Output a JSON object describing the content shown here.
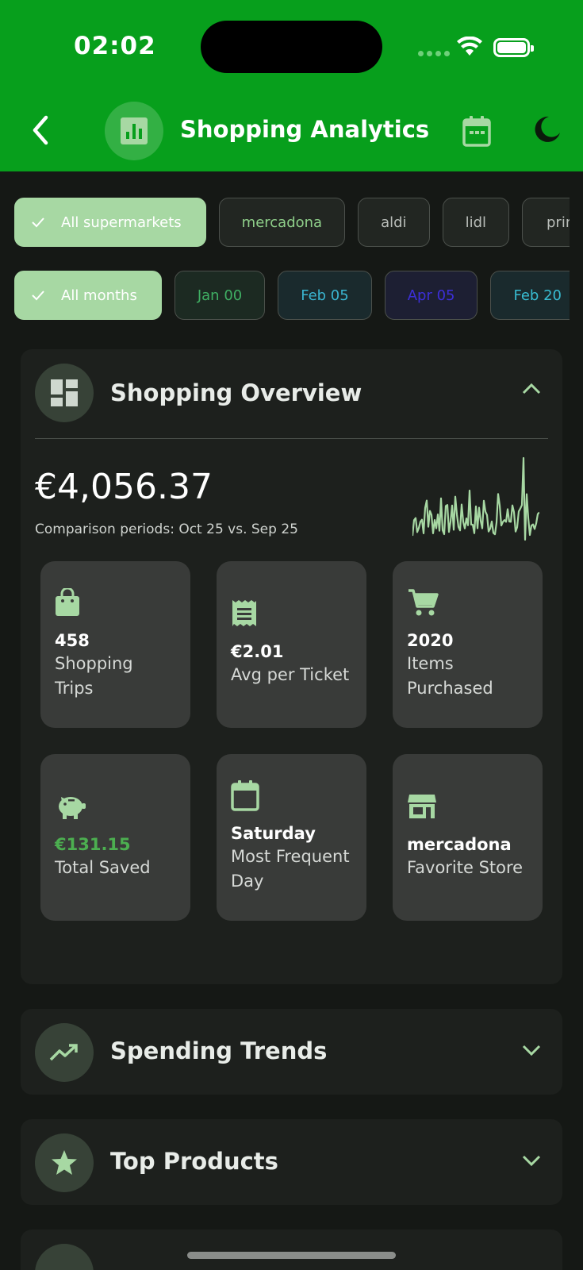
{
  "status_bar": {
    "time": "02:02"
  },
  "app_bar": {
    "title": "Shopping Analytics"
  },
  "filters": {
    "stores": [
      {
        "label": "All supermarkets",
        "selected": true,
        "color": "#ffffff"
      },
      {
        "label": "mercadona",
        "selected": false,
        "color": "#8fcf8a"
      },
      {
        "label": "aldi",
        "selected": false,
        "color": "#b9bdb9"
      },
      {
        "label": "lidl",
        "selected": false,
        "color": "#b9bdb9"
      },
      {
        "label": "prim",
        "selected": false,
        "color": "#b9bdb9"
      }
    ],
    "months": [
      {
        "label": "All months",
        "selected": true,
        "color": "#ffffff"
      },
      {
        "label": "Jan 00",
        "selected": false,
        "color": "#3fae63"
      },
      {
        "label": "Feb 05",
        "selected": false,
        "color": "#3ab4cf"
      },
      {
        "label": "Apr 05",
        "selected": false,
        "color": "#3c2fd8"
      },
      {
        "label": "Feb 20",
        "selected": false,
        "color": "#38bcd2"
      }
    ]
  },
  "overview": {
    "title": "Shopping Overview",
    "total": "€4,056.37",
    "comparison": "Comparison periods: Oct 25 vs. Sep 25",
    "stats": [
      {
        "icon": "shopping-bag-icon",
        "value": "458",
        "label": "Shopping Trips",
        "value_color": "#ffffff"
      },
      {
        "icon": "receipt-icon",
        "value": "€2.01",
        "label": "Avg per Ticket",
        "value_color": "#ffffff"
      },
      {
        "icon": "cart-icon",
        "value": "2020",
        "label": "Items Purchased",
        "value_color": "#ffffff"
      },
      {
        "icon": "piggy-bank-icon",
        "value": "€131.15",
        "label": "Total Saved",
        "value_color": "#4caf50"
      },
      {
        "icon": "calendar-icon",
        "value": "Saturday",
        "label": "Most Frequent Day",
        "value_color": "#ffffff"
      },
      {
        "icon": "store-icon",
        "value": "mercadona",
        "label": "Favorite Store",
        "value_color": "#ffffff"
      }
    ]
  },
  "sections": {
    "trends": {
      "title": "Spending Trends"
    },
    "products": {
      "title": "Top Products"
    }
  },
  "colors": {
    "header": "#079f1c",
    "accent": "#a7d8a3",
    "background": "#151815",
    "card": "#1d201d",
    "tile": "#393b39",
    "saved": "#4caf50"
  }
}
